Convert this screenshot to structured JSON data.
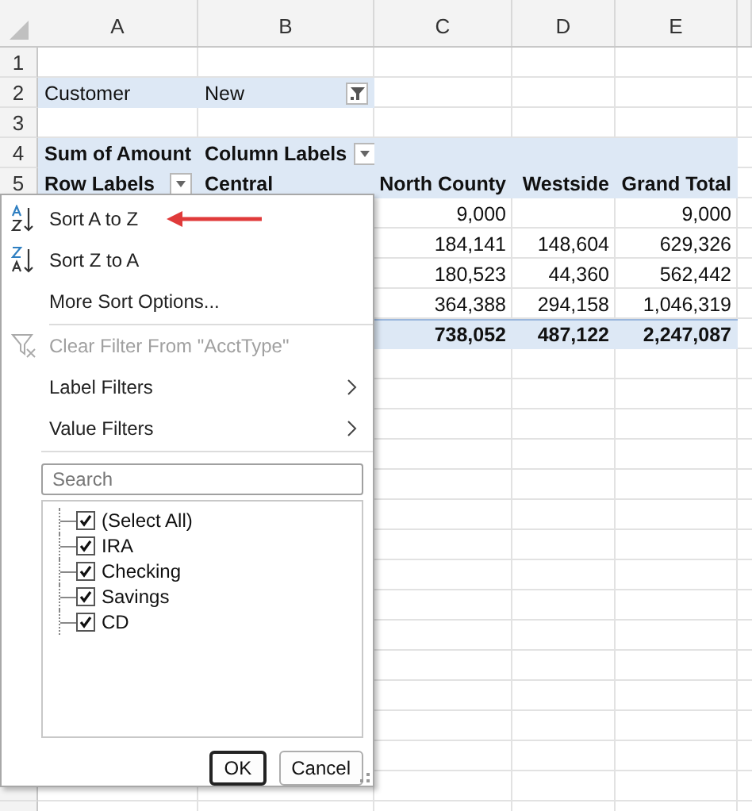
{
  "columns": [
    "A",
    "B",
    "C",
    "D",
    "E"
  ],
  "rows": [
    {
      "number": "1",
      "kind": "blank"
    },
    {
      "number": "2",
      "kind": "filter",
      "a": "Customer",
      "b": "New"
    },
    {
      "number": "3",
      "kind": "blank"
    },
    {
      "number": "4",
      "kind": "header",
      "a": "Sum of Amount",
      "b": "Column Labels",
      "b_dropdown": true
    },
    {
      "number": "5",
      "kind": "header",
      "a": "Row Labels",
      "a_dropdown": true,
      "b": "Central",
      "c": "North County",
      "d": "Westside",
      "e": "Grand Total"
    },
    {
      "kind": "data",
      "c": "9,000",
      "e": "9,000"
    },
    {
      "kind": "data",
      "c": "184,141",
      "d": "148,604",
      "e": "629,326"
    },
    {
      "kind": "data",
      "c": "180,523",
      "d": "44,360",
      "e": "562,442"
    },
    {
      "kind": "data",
      "c": "364,388",
      "d": "294,158",
      "e": "1,046,319"
    },
    {
      "kind": "total",
      "c": "738,052",
      "d": "487,122",
      "e": "2,247,087"
    }
  ],
  "filter_menu": {
    "items": [
      {
        "kind": "sort_asc",
        "label": "Sort A to Z",
        "disabled": false
      },
      {
        "kind": "sort_desc",
        "label": "Sort Z to A",
        "disabled": false
      },
      {
        "kind": "plain",
        "label": "More Sort Options...",
        "disabled": false
      },
      {
        "kind": "separator"
      },
      {
        "kind": "clear",
        "label": "Clear Filter From \"AcctType\"",
        "disabled": true
      },
      {
        "kind": "submenu",
        "label": "Label Filters",
        "disabled": false
      },
      {
        "kind": "submenu",
        "label": "Value Filters",
        "disabled": false
      }
    ],
    "search": {
      "placeholder": "Search"
    },
    "values": [
      {
        "label": "(Select All)",
        "checked": true
      },
      {
        "label": "IRA",
        "checked": true
      },
      {
        "label": "Checking",
        "checked": true
      },
      {
        "label": "Savings",
        "checked": true
      },
      {
        "label": "CD",
        "checked": true
      }
    ],
    "buttons": [
      {
        "label": "OK",
        "default": true
      },
      {
        "label": "Cancel",
        "default": false
      }
    ]
  }
}
